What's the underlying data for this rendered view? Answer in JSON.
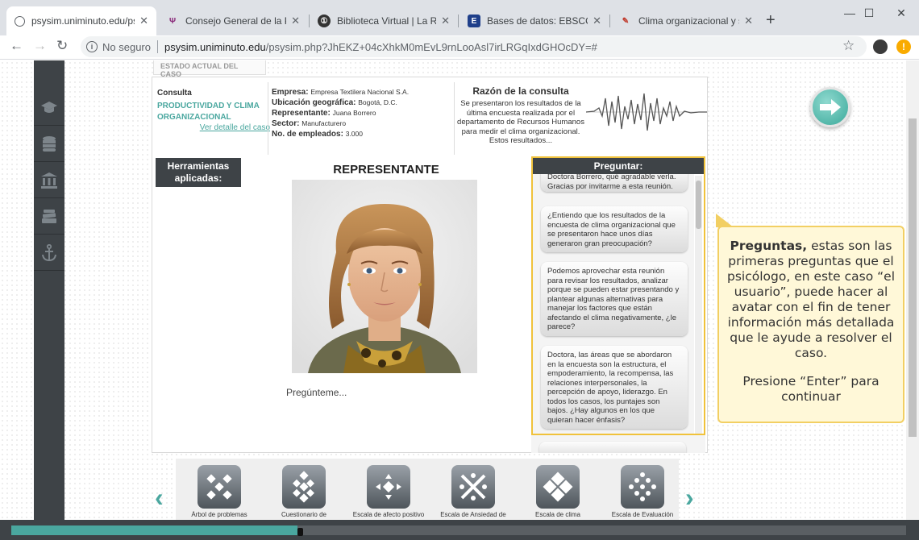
{
  "browser": {
    "tabs": [
      {
        "title": "psysim.uniminuto.edu/psysi",
        "active": true
      },
      {
        "title": "Consejo General de la Psico",
        "active": false
      },
      {
        "title": "Biblioteca Virtual | La Red C",
        "active": false
      },
      {
        "title": "Bases de datos: EBSCOhost",
        "active": false
      },
      {
        "title": "Clima organizacional y satis",
        "active": false
      }
    ],
    "new_tab": "+",
    "security": "No seguro",
    "url_host": "psysim.uniminuto.edu",
    "url_path": "/psysim.php?JhEKZ+04cXhkM0mEvL9rnLooAsl7irLRGqIxdGHOcDY=#"
  },
  "page": {
    "estado": "ESTADO ACTUAL DEL CASO",
    "consulta_label": "Consulta",
    "proyecto": "PRODUCTIVIDAD Y CLIMA ORGANIZACIONAL",
    "detalle_link": "Ver detalle del caso",
    "empresa": {
      "empresa_label": "Empresa:",
      "empresa": "Empresa Textilera Nacional S.A.",
      "ubicacion_label": "Ubicación geográfica:",
      "ubicacion": "Bogotá, D.C.",
      "representante_label": "Representante:",
      "representante": "Juana Borrero",
      "sector_label": "Sector:",
      "sector": "Manufacturero",
      "empleados_label": "No. de empleados:",
      "empleados": "3.000"
    },
    "razon_title": "Razón de la consulta",
    "razon_text": "Se presentaron los resultados de la última encuesta realizada por el departamento de Recursos Humanos para medir el clima organizacional. Estos resultados...",
    "herramientas": "Herramientas aplicadas:",
    "representante_title": "REPRESENTANTE",
    "pregunteme": "Pregúnteme...",
    "preguntar_title": "Preguntar:",
    "preguntas": [
      "Doctora Borrero, qué agradable verla. Gracias por invitarme a esta reunión.",
      "¿Entiendo que los resultados de la encuesta de clima organizacional que se presentaron hace unos días generaron gran preocupación?",
      "Podemos aprovechar esta reunión para revisar los resultados, analizar porque se pueden estar presentando y plantear algunas alternativas para manejar los factores que están afectando el clima negativamente, ¿le parece?",
      "Doctora, las áreas que se abordaron en la encuesta son la estructura, el empoderamiento, la recompensa, las relaciones interpersonales, la percepción de apoyo, liderazgo. En todos los casos, los puntajes son bajos. ¿Hay algunos en los que quieran hacer énfasis?"
    ],
    "tools": [
      "Árbol de problemas",
      "Cuestionario de",
      "Escala de afecto positivo",
      "Escala de Ansiedad de",
      "Escala de clima",
      "Escala de Evaluación"
    ]
  },
  "callout": {
    "bold": "Preguntas,",
    "text": " estas son las primeras preguntas que el psicólogo, en este caso “el usuario”, puede hacer al avatar con el fin de tener información más detallada que le ayude a resolver el caso.",
    "enter": "Presione “Enter” para continuar"
  },
  "progress": {
    "value": 0.32
  },
  "colors": {
    "accent": "#4aa79f",
    "dark": "#3e4347",
    "callout_bg": "#fff8d8",
    "callout_border": "#f2cf63"
  }
}
